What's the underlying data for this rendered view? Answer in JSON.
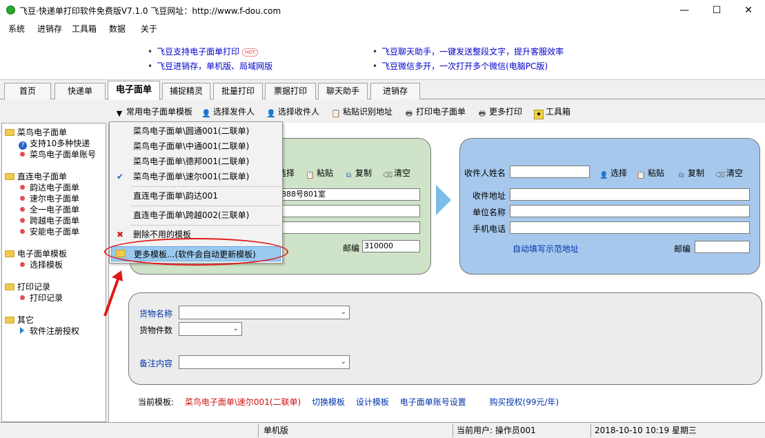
{
  "window": {
    "title": "飞豆·快递单打印软件免费版V7.1.0   飞豆网址：http://www.f-dou.com",
    "minimize": "—",
    "maximize": "☐",
    "close": "✕"
  },
  "menu": [
    "系统",
    "进销存",
    "工具箱",
    "数据",
    "关于"
  ],
  "banner": {
    "left": [
      "飞豆支持电子面单打印",
      "飞豆进销存，单机版、局域网版"
    ],
    "hot": "HOT",
    "right": [
      "飞豆聊天助手，一键发送整段文字，提升客服效率",
      "飞豆微信多开，一次打开多个微信(电脑PC版)"
    ]
  },
  "tabs": [
    "首页",
    "快递单",
    "电子面单",
    "捕捉精灵",
    "批量打印",
    "票据打印",
    "聊天助手",
    "进销存"
  ],
  "toolbar": [
    "常用电子面单模板",
    "选择发件人",
    "选择收件人",
    "粘贴识别地址",
    "打印电子面单",
    "更多打印",
    "工具箱"
  ],
  "sidebar": {
    "groups": [
      {
        "label": "菜鸟电子面单",
        "items": [
          "支持10多种快递",
          "菜鸟电子面单账号"
        ]
      },
      {
        "label": "直连电子面单",
        "items": [
          "韵达电子面单",
          "速尔电子面单",
          "全一电子面单",
          "跨越电子面单",
          "安能电子面单"
        ]
      },
      {
        "label": "电子面单模板",
        "items": [
          "选择模板"
        ]
      },
      {
        "label": "打印记录",
        "items": [
          "打印记录"
        ]
      },
      {
        "label": "其它",
        "items": [
          "软件注册授权"
        ]
      }
    ]
  },
  "dropdown": {
    "items": [
      "菜鸟电子面单\\圆通001(二联单)",
      "菜鸟电子面单\\中通001(二联单)",
      "菜鸟电子面单\\德邦001(二联单)",
      "菜鸟电子面单\\速尔001(二联单)",
      "直连电子面单\\韵达001",
      "直连电子面单\\跨越002(三联单)",
      "删除不用的模板",
      "更多模板...(软件会自动更新模板)"
    ]
  },
  "sender": {
    "actions": [
      "选择",
      "粘贴",
      "复制",
      "清空"
    ],
    "address_value": "888号801室",
    "zip_label": "邮编",
    "zip_value": "310000"
  },
  "receiver": {
    "name_label": "收件人姓名",
    "actions": [
      "选择",
      "粘贴",
      "复制",
      "清空"
    ],
    "address_label": "收件地址",
    "company_label": "单位名称",
    "phone_label": "手机电话",
    "autofill_link": "自动填写示范地址",
    "zip_label": "邮编"
  },
  "goods": {
    "name_label": "货物名称",
    "count_label": "货物件数",
    "note_label": "备注内容"
  },
  "bottom": {
    "current_label": "当前模板:",
    "current_value": "菜鸟电子面单\\速尔001(二联单)",
    "links": [
      "切换模板",
      "设计模板",
      "电子面单账号设置",
      "购买授权(99元/年)"
    ]
  },
  "status": {
    "mode": "单机版",
    "user": "当前用户: 操作员001",
    "datetime": "2018-10-10 10:19 星期三"
  },
  "colors": {
    "sender_panel": "#cfe3c8",
    "receiver_panel": "#a6c8ec",
    "highlight": "#99c9ef",
    "link_blue": "#0033aa",
    "template_red": "#d01010"
  }
}
